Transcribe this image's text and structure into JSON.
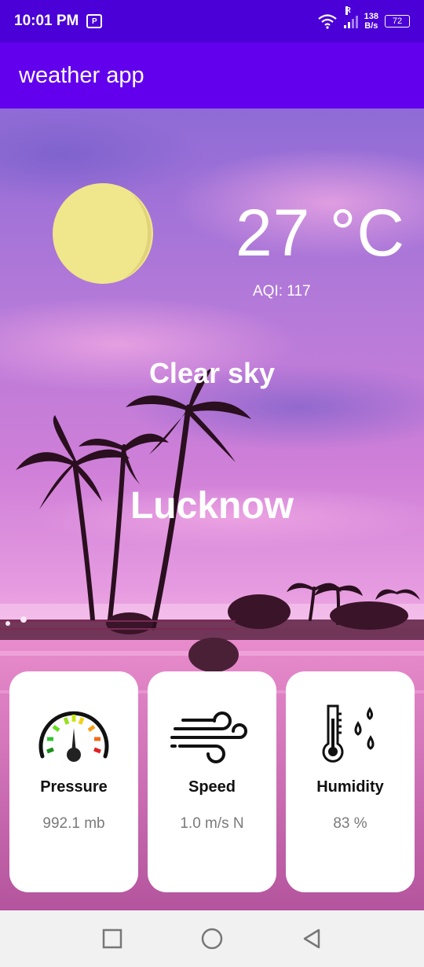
{
  "status_bar": {
    "time": "10:01 PM",
    "sim_badge": "P",
    "signal_label": "R",
    "net_speed_value": "138",
    "net_speed_unit": "B/s",
    "battery": "72"
  },
  "app_bar": {
    "title": "weather app"
  },
  "weather": {
    "temperature": "27 °C",
    "aqi": "AQI: 117",
    "condition": "Clear sky",
    "city": "Lucknow"
  },
  "cards": [
    {
      "label": "Pressure",
      "value": "992.1 mb",
      "icon": "gauge-icon"
    },
    {
      "label": "Speed",
      "value": "1.0 m/s N",
      "icon": "wind-icon"
    },
    {
      "label": "Humidity",
      "value": "83 %",
      "icon": "thermometer-drops-icon"
    }
  ],
  "nav": {
    "icons": [
      "recents-icon",
      "home-icon",
      "back-icon"
    ]
  },
  "colors": {
    "status_bar": "#4a00d6",
    "app_bar": "#6200ee",
    "sun": "#f0e68c"
  }
}
